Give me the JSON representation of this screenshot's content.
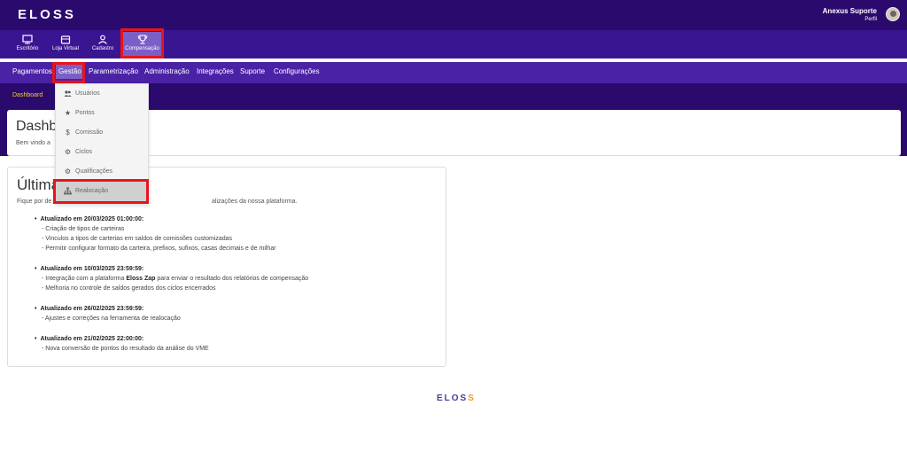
{
  "header": {
    "logo_text": "ELOSS",
    "user_name": "Anexus Suporte",
    "user_profile": "Perfil"
  },
  "modules": [
    {
      "label": "Escritório",
      "icon": "monitor-icon"
    },
    {
      "label": "Loja Virtual",
      "icon": "store-icon"
    },
    {
      "label": "Cadastro",
      "icon": "user-icon"
    },
    {
      "label": "Compensação",
      "icon": "trophy-icon",
      "active": true
    }
  ],
  "menu": [
    {
      "label": "Pagamentos"
    },
    {
      "label": "Gestão",
      "active": true
    },
    {
      "label": "Parametrização"
    },
    {
      "label": "Administração"
    },
    {
      "label": "Integrações"
    },
    {
      "label": "Suporte"
    },
    {
      "label": "Configurações"
    }
  ],
  "breadcrumb": "Dashboard",
  "dropdown": [
    {
      "label": "Usuários",
      "icon": "users-icon"
    },
    {
      "label": "Pontos",
      "icon": "star-icon"
    },
    {
      "label": "Comissão",
      "icon": "dollar-icon"
    },
    {
      "label": "Ciclos",
      "icon": "gear-icon"
    },
    {
      "label": "Qualificações",
      "icon": "gear-icon"
    },
    {
      "label": "Realocação",
      "icon": "sitemap-icon",
      "selected": true
    }
  ],
  "dashboard": {
    "title": "Dashb",
    "subtitle": "Bem vindo a"
  },
  "updates": {
    "title": "Última",
    "subtitle_start": "Fique por de",
    "subtitle_end": "alizações da nossa plataforma.",
    "entries": [
      {
        "heading": "Atualizado em 20/03/2025 01:00:00:",
        "lines": [
          "- Criação de tipos de carteiras",
          "- Vinculos a tipos de carterias em saldos de comissões customizadas",
          "- Permitir configurar formato da carteira, prefixos, sufixos, casas decimais e de milhar"
        ]
      },
      {
        "heading": "Atualizado em 10/03/2025 23:59:59:",
        "lines": [
          "- Melhoria no controle de saldos gerados dos ciclos encerrados"
        ],
        "zap_line": {
          "before": "- Integração com a plataforma ",
          "bold": "Eloss Zap",
          "after": " para enviar o resultado dos relatórios de compensação"
        }
      },
      {
        "heading": "Atualizado em 26/02/2025 23:59:59:",
        "lines": [
          "- Ajustes e correções na ferramenta de realocação"
        ]
      },
      {
        "heading": "Atualizado em 21/02/2025 22:00:00:",
        "lines": [
          "- Nova conversão de pontos do resultado da análise do VME"
        ]
      }
    ]
  },
  "footer": {
    "logo_main": "ELOS",
    "logo_accent": "S"
  },
  "colors": {
    "topbar": "#2b0a6e",
    "modulebar": "#3a1591",
    "menubar": "#4a22a6",
    "active": "#7b5fc7",
    "highlight": "#e8141a",
    "breadcrumb": "#f5cd2a"
  }
}
